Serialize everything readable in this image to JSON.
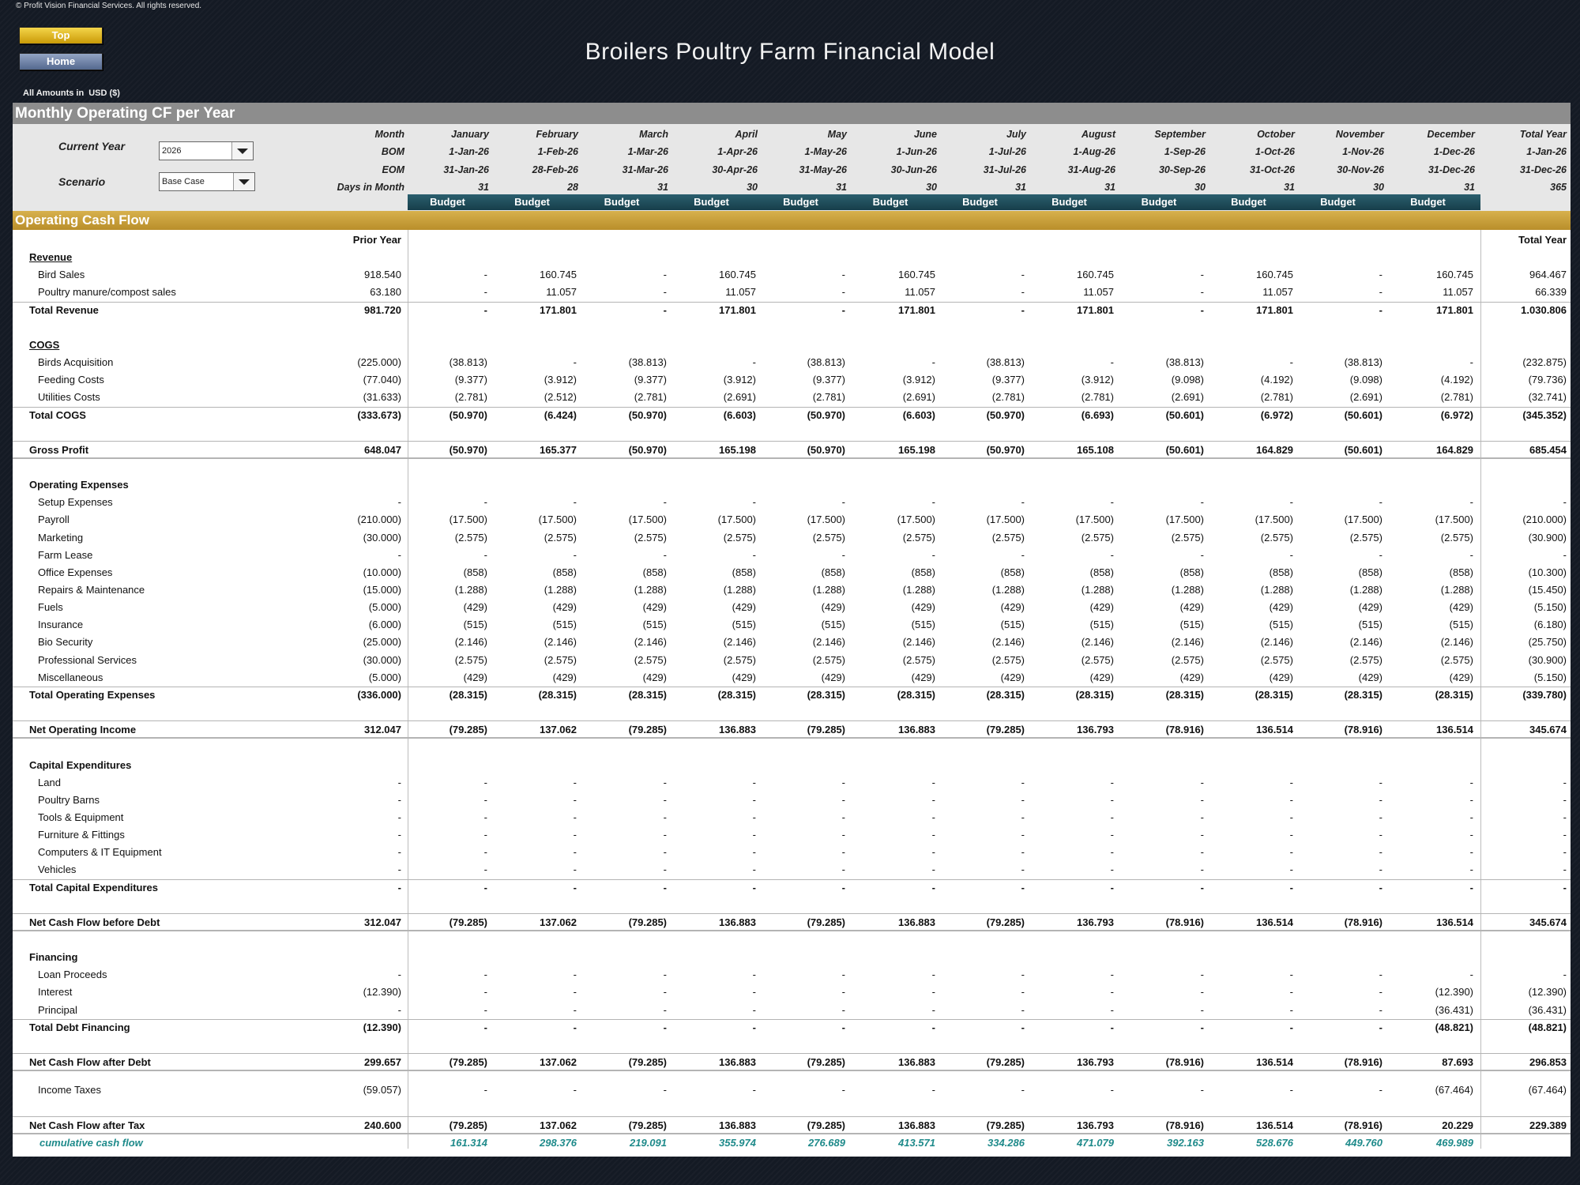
{
  "copyright": "© Profit Vision Financial Services. All rights reserved.",
  "buttons": {
    "top": "Top",
    "home": "Home"
  },
  "title": "Broilers Poultry Farm Financial Model",
  "amounts": {
    "label": "All Amounts in",
    "currency": "USD ($)"
  },
  "section_title": "Monthly Operating CF per Year",
  "controls": {
    "current_year_label": "Current Year",
    "current_year_value": "2026",
    "scenario_label": "Scenario",
    "scenario_value": "Base Case"
  },
  "header_labels": {
    "month": "Month",
    "bom": "BOM",
    "eom": "EOM",
    "days": "Days in Month"
  },
  "months": [
    {
      "name": "January",
      "bom": "1-Jan-26",
      "eom": "31-Jan-26",
      "days": "31"
    },
    {
      "name": "February",
      "bom": "1-Feb-26",
      "eom": "28-Feb-26",
      "days": "28"
    },
    {
      "name": "March",
      "bom": "1-Mar-26",
      "eom": "31-Mar-26",
      "days": "31"
    },
    {
      "name": "April",
      "bom": "1-Apr-26",
      "eom": "30-Apr-26",
      "days": "30"
    },
    {
      "name": "May",
      "bom": "1-May-26",
      "eom": "31-May-26",
      "days": "31"
    },
    {
      "name": "June",
      "bom": "1-Jun-26",
      "eom": "30-Jun-26",
      "days": "30"
    },
    {
      "name": "July",
      "bom": "1-Jul-26",
      "eom": "31-Jul-26",
      "days": "31"
    },
    {
      "name": "August",
      "bom": "1-Aug-26",
      "eom": "31-Aug-26",
      "days": "31"
    },
    {
      "name": "September",
      "bom": "1-Sep-26",
      "eom": "30-Sep-26",
      "days": "30"
    },
    {
      "name": "October",
      "bom": "1-Oct-26",
      "eom": "31-Oct-26",
      "days": "31"
    },
    {
      "name": "November",
      "bom": "1-Nov-26",
      "eom": "30-Nov-26",
      "days": "30"
    },
    {
      "name": "December",
      "bom": "1-Dec-26",
      "eom": "31-Dec-26",
      "days": "31"
    }
  ],
  "total_header": {
    "name": "Total Year",
    "bom": "1-Jan-26",
    "eom": "31-Dec-26",
    "days": "365"
  },
  "budget_label": "Budget",
  "cf_title": "Operating Cash Flow",
  "prior_year_label": "Prior Year",
  "total_year_label": "Total Year",
  "rows": [
    {
      "label": "Revenue",
      "type": "section"
    },
    {
      "label": "Bird Sales",
      "type": "item",
      "prior": "918.540",
      "months": [
        "-",
        "160.745",
        "-",
        "160.745",
        "-",
        "160.745",
        "-",
        "160.745",
        "-",
        "160.745",
        "-",
        "160.745"
      ],
      "total": "964.467"
    },
    {
      "label": "Poultry manure/compost sales",
      "type": "item",
      "prior": "63.180",
      "months": [
        "-",
        "11.057",
        "-",
        "11.057",
        "-",
        "11.057",
        "-",
        "11.057",
        "-",
        "11.057",
        "-",
        "11.057"
      ],
      "total": "66.339"
    },
    {
      "label": "Total Revenue",
      "type": "total",
      "prior": "981.720",
      "months": [
        "-",
        "171.801",
        "-",
        "171.801",
        "-",
        "171.801",
        "-",
        "171.801",
        "-",
        "171.801",
        "-",
        "171.801"
      ],
      "total": "1.030.806"
    },
    {
      "type": "blank"
    },
    {
      "label": "COGS",
      "type": "section"
    },
    {
      "label": "Birds Acquisition",
      "type": "item",
      "prior": "(225.000)",
      "months": [
        "(38.813)",
        "-",
        "(38.813)",
        "-",
        "(38.813)",
        "-",
        "(38.813)",
        "-",
        "(38.813)",
        "-",
        "(38.813)",
        "-"
      ],
      "total": "(232.875)"
    },
    {
      "label": "Feeding Costs",
      "type": "item",
      "prior": "(77.040)",
      "months": [
        "(9.377)",
        "(3.912)",
        "(9.377)",
        "(3.912)",
        "(9.377)",
        "(3.912)",
        "(9.377)",
        "(3.912)",
        "(9.098)",
        "(4.192)",
        "(9.098)",
        "(4.192)"
      ],
      "total": "(79.736)"
    },
    {
      "label": "Utilities Costs",
      "type": "item",
      "prior": "(31.633)",
      "months": [
        "(2.781)",
        "(2.512)",
        "(2.781)",
        "(2.691)",
        "(2.781)",
        "(2.691)",
        "(2.781)",
        "(2.781)",
        "(2.691)",
        "(2.781)",
        "(2.691)",
        "(2.781)"
      ],
      "total": "(32.741)"
    },
    {
      "label": "Total COGS",
      "type": "total",
      "prior": "(333.673)",
      "months": [
        "(50.970)",
        "(6.424)",
        "(50.970)",
        "(6.603)",
        "(50.970)",
        "(6.603)",
        "(50.970)",
        "(6.693)",
        "(50.601)",
        "(6.972)",
        "(50.601)",
        "(6.972)"
      ],
      "total": "(345.352)"
    },
    {
      "type": "blank"
    },
    {
      "label": "Gross Profit",
      "type": "grand",
      "prior": "648.047",
      "months": [
        "(50.970)",
        "165.377",
        "(50.970)",
        "165.198",
        "(50.970)",
        "165.198",
        "(50.970)",
        "165.108",
        "(50.601)",
        "164.829",
        "(50.601)",
        "164.829"
      ],
      "total": "685.454"
    },
    {
      "type": "blank"
    },
    {
      "label": "Operating Expenses",
      "type": "section_plain"
    },
    {
      "label": "Setup Expenses",
      "type": "item",
      "prior": "-",
      "months": [
        "-",
        "-",
        "-",
        "-",
        "-",
        "-",
        "-",
        "-",
        "-",
        "-",
        "-",
        "-"
      ],
      "total": "-"
    },
    {
      "label": "Payroll",
      "type": "item",
      "prior": "(210.000)",
      "months": [
        "(17.500)",
        "(17.500)",
        "(17.500)",
        "(17.500)",
        "(17.500)",
        "(17.500)",
        "(17.500)",
        "(17.500)",
        "(17.500)",
        "(17.500)",
        "(17.500)",
        "(17.500)"
      ],
      "total": "(210.000)"
    },
    {
      "label": "Marketing",
      "type": "item",
      "prior": "(30.000)",
      "months": [
        "(2.575)",
        "(2.575)",
        "(2.575)",
        "(2.575)",
        "(2.575)",
        "(2.575)",
        "(2.575)",
        "(2.575)",
        "(2.575)",
        "(2.575)",
        "(2.575)",
        "(2.575)"
      ],
      "total": "(30.900)"
    },
    {
      "label": "Farm Lease",
      "type": "item",
      "prior": "-",
      "months": [
        "-",
        "-",
        "-",
        "-",
        "-",
        "-",
        "-",
        "-",
        "-",
        "-",
        "-",
        "-"
      ],
      "total": "-"
    },
    {
      "label": "Office Expenses",
      "type": "item",
      "prior": "(10.000)",
      "months": [
        "(858)",
        "(858)",
        "(858)",
        "(858)",
        "(858)",
        "(858)",
        "(858)",
        "(858)",
        "(858)",
        "(858)",
        "(858)",
        "(858)"
      ],
      "total": "(10.300)"
    },
    {
      "label": "Repairs & Maintenance",
      "type": "item",
      "prior": "(15.000)",
      "months": [
        "(1.288)",
        "(1.288)",
        "(1.288)",
        "(1.288)",
        "(1.288)",
        "(1.288)",
        "(1.288)",
        "(1.288)",
        "(1.288)",
        "(1.288)",
        "(1.288)",
        "(1.288)"
      ],
      "total": "(15.450)"
    },
    {
      "label": "Fuels",
      "type": "item",
      "prior": "(5.000)",
      "months": [
        "(429)",
        "(429)",
        "(429)",
        "(429)",
        "(429)",
        "(429)",
        "(429)",
        "(429)",
        "(429)",
        "(429)",
        "(429)",
        "(429)"
      ],
      "total": "(5.150)"
    },
    {
      "label": "Insurance",
      "type": "item",
      "prior": "(6.000)",
      "months": [
        "(515)",
        "(515)",
        "(515)",
        "(515)",
        "(515)",
        "(515)",
        "(515)",
        "(515)",
        "(515)",
        "(515)",
        "(515)",
        "(515)"
      ],
      "total": "(6.180)"
    },
    {
      "label": "Bio Security",
      "type": "item",
      "prior": "(25.000)",
      "months": [
        "(2.146)",
        "(2.146)",
        "(2.146)",
        "(2.146)",
        "(2.146)",
        "(2.146)",
        "(2.146)",
        "(2.146)",
        "(2.146)",
        "(2.146)",
        "(2.146)",
        "(2.146)"
      ],
      "total": "(25.750)"
    },
    {
      "label": "Professional Services",
      "type": "item",
      "prior": "(30.000)",
      "months": [
        "(2.575)",
        "(2.575)",
        "(2.575)",
        "(2.575)",
        "(2.575)",
        "(2.575)",
        "(2.575)",
        "(2.575)",
        "(2.575)",
        "(2.575)",
        "(2.575)",
        "(2.575)"
      ],
      "total": "(30.900)"
    },
    {
      "label": "Miscellaneous",
      "type": "item",
      "prior": "(5.000)",
      "months": [
        "(429)",
        "(429)",
        "(429)",
        "(429)",
        "(429)",
        "(429)",
        "(429)",
        "(429)",
        "(429)",
        "(429)",
        "(429)",
        "(429)"
      ],
      "total": "(5.150)"
    },
    {
      "label": "Total Operating Expenses",
      "type": "total",
      "prior": "(336.000)",
      "months": [
        "(28.315)",
        "(28.315)",
        "(28.315)",
        "(28.315)",
        "(28.315)",
        "(28.315)",
        "(28.315)",
        "(28.315)",
        "(28.315)",
        "(28.315)",
        "(28.315)",
        "(28.315)"
      ],
      "total": "(339.780)"
    },
    {
      "type": "blank"
    },
    {
      "label": "Net Operating Income",
      "type": "grand",
      "prior": "312.047",
      "months": [
        "(79.285)",
        "137.062",
        "(79.285)",
        "136.883",
        "(79.285)",
        "136.883",
        "(79.285)",
        "136.793",
        "(78.916)",
        "136.514",
        "(78.916)",
        "136.514"
      ],
      "total": "345.674"
    },
    {
      "type": "blank"
    },
    {
      "label": "Capital Expenditures",
      "type": "section_plain"
    },
    {
      "label": "Land",
      "type": "item",
      "prior": "-",
      "months": [
        "-",
        "-",
        "-",
        "-",
        "-",
        "-",
        "-",
        "-",
        "-",
        "-",
        "-",
        "-"
      ],
      "total": "-"
    },
    {
      "label": "Poultry Barns",
      "type": "item",
      "prior": "-",
      "months": [
        "-",
        "-",
        "-",
        "-",
        "-",
        "-",
        "-",
        "-",
        "-",
        "-",
        "-",
        "-"
      ],
      "total": "-"
    },
    {
      "label": "Tools & Equipment",
      "type": "item",
      "prior": "-",
      "months": [
        "-",
        "-",
        "-",
        "-",
        "-",
        "-",
        "-",
        "-",
        "-",
        "-",
        "-",
        "-"
      ],
      "total": "-"
    },
    {
      "label": "Furniture & Fittings",
      "type": "item",
      "prior": "-",
      "months": [
        "-",
        "-",
        "-",
        "-",
        "-",
        "-",
        "-",
        "-",
        "-",
        "-",
        "-",
        "-"
      ],
      "total": "-"
    },
    {
      "label": "Computers & IT Equipment",
      "type": "item",
      "prior": "-",
      "months": [
        "-",
        "-",
        "-",
        "-",
        "-",
        "-",
        "-",
        "-",
        "-",
        "-",
        "-",
        "-"
      ],
      "total": "-"
    },
    {
      "label": "Vehicles",
      "type": "item",
      "prior": "-",
      "months": [
        "-",
        "-",
        "-",
        "-",
        "-",
        "-",
        "-",
        "-",
        "-",
        "-",
        "-",
        "-"
      ],
      "total": "-"
    },
    {
      "label": "Total Capital Expenditures",
      "type": "total",
      "prior": "-",
      "months": [
        "-",
        "-",
        "-",
        "-",
        "-",
        "-",
        "-",
        "-",
        "-",
        "-",
        "-",
        "-"
      ],
      "total": "-"
    },
    {
      "type": "blank"
    },
    {
      "label": "Net Cash Flow before Debt",
      "type": "grand",
      "prior": "312.047",
      "months": [
        "(79.285)",
        "137.062",
        "(79.285)",
        "136.883",
        "(79.285)",
        "136.883",
        "(79.285)",
        "136.793",
        "(78.916)",
        "136.514",
        "(78.916)",
        "136.514"
      ],
      "total": "345.674"
    },
    {
      "type": "blank"
    },
    {
      "label": "Financing",
      "type": "section_plain"
    },
    {
      "label": "Loan Proceeds",
      "type": "item",
      "prior": "-",
      "months": [
        "-",
        "-",
        "-",
        "-",
        "-",
        "-",
        "-",
        "-",
        "-",
        "-",
        "-",
        "-"
      ],
      "total": "-"
    },
    {
      "label": "Interest",
      "type": "item",
      "prior": "(12.390)",
      "months": [
        "-",
        "-",
        "-",
        "-",
        "-",
        "-",
        "-",
        "-",
        "-",
        "-",
        "-",
        "(12.390)"
      ],
      "total": "(12.390)"
    },
    {
      "label": "Principal",
      "type": "item",
      "prior": "-",
      "months": [
        "-",
        "-",
        "-",
        "-",
        "-",
        "-",
        "-",
        "-",
        "-",
        "-",
        "-",
        "(36.431)"
      ],
      "total": "(36.431)"
    },
    {
      "label": "Total Debt Financing",
      "type": "total",
      "prior": "(12.390)",
      "months": [
        "-",
        "-",
        "-",
        "-",
        "-",
        "-",
        "-",
        "-",
        "-",
        "-",
        "-",
        "(48.821)"
      ],
      "total": "(48.821)"
    },
    {
      "type": "blank"
    },
    {
      "label": "Net Cash Flow after Debt",
      "type": "grand",
      "prior": "299.657",
      "months": [
        "(79.285)",
        "137.062",
        "(79.285)",
        "136.883",
        "(79.285)",
        "136.883",
        "(79.285)",
        "136.793",
        "(78.916)",
        "136.514",
        "(78.916)",
        "87.693"
      ],
      "total": "296.853"
    },
    {
      "type": "blank_half"
    },
    {
      "label": "Income Taxes",
      "type": "item",
      "prior": "(59.057)",
      "months": [
        "-",
        "-",
        "-",
        "-",
        "-",
        "-",
        "-",
        "-",
        "-",
        "-",
        "-",
        "(67.464)"
      ],
      "total": "(67.464)"
    },
    {
      "type": "blank"
    },
    {
      "label": "Net Cash Flow after Tax",
      "type": "grand",
      "prior": "240.600",
      "months": [
        "(79.285)",
        "137.062",
        "(79.285)",
        "136.883",
        "(79.285)",
        "136.883",
        "(79.285)",
        "136.793",
        "(78.916)",
        "136.514",
        "(78.916)",
        "20.229"
      ],
      "total": "229.389"
    },
    {
      "label": "cumulative cash flow",
      "type": "cumulative",
      "prior": "",
      "months": [
        "161.314",
        "298.376",
        "219.091",
        "355.974",
        "276.689",
        "413.571",
        "334.286",
        "471.079",
        "392.163",
        "528.676",
        "449.760",
        "469.989"
      ],
      "total": ""
    }
  ]
}
